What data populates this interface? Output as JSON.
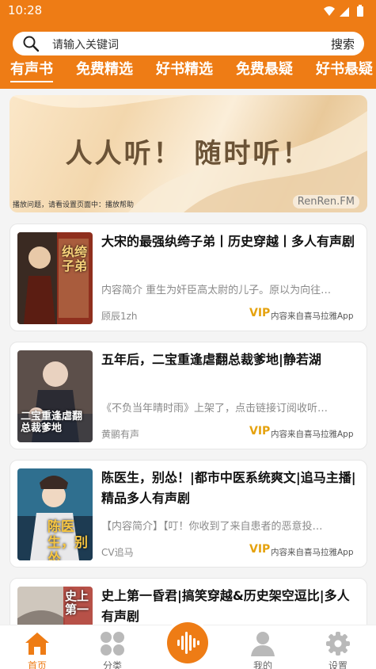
{
  "status_bar": {
    "time": "10:28"
  },
  "search": {
    "placeholder": "请输入关键词",
    "button_label": "搜索"
  },
  "tabs": [
    {
      "label": "有声书",
      "active": true
    },
    {
      "label": "免费精选"
    },
    {
      "label": "好书精选"
    },
    {
      "label": "免费悬疑"
    },
    {
      "label": "好书悬疑"
    }
  ],
  "banner": {
    "title": "人人听！ 随时听！",
    "footnote": "播放问题，请看设置页面中：播放帮助",
    "logo": "RenRen.FM"
  },
  "books": [
    {
      "title": "大宋的最强纨绔子弟丨历史穿越丨多人有声剧",
      "desc": "内容简介 重生为奸臣高太尉的儿子。原以为向往…",
      "author": "顾辰1zh",
      "vip": "VIP",
      "source": "内容来自喜马拉雅App",
      "cover_text": "纨绔子弟"
    },
    {
      "title": "五年后，二宝重逢虐翻总裁爹地|静若湖",
      "desc": "《不负当年晴时雨》上架了，点击链接订阅收听…",
      "author": "黄鹂有声",
      "vip": "VIP",
      "source": "内容来自喜马拉雅App",
      "cover_text": "二宝重逢虐翻总裁爹地"
    },
    {
      "title": "陈医生，别怂！|都市中医系统爽文|追马主播|精品多人有声剧",
      "desc": "【内容简介】【叮！你收到了来自患者的恶意投…",
      "author": "CV追马",
      "vip": "VIP",
      "source": "内容来自喜马拉雅App",
      "cover_text": "陈医生，别怂"
    },
    {
      "title": "史上第一昏君|搞笑穿越&历史架空逗比|多人有声剧",
      "desc": "",
      "author": "",
      "vip": "",
      "source": "",
      "cover_text": "史上第一"
    }
  ],
  "bottom_nav": [
    {
      "label": "首页",
      "icon": "home-icon",
      "active": true
    },
    {
      "label": "分类",
      "icon": "category-icon"
    },
    {
      "label": "",
      "icon": "sound-wave-icon"
    },
    {
      "label": "我的",
      "icon": "person-icon"
    },
    {
      "label": "设置",
      "icon": "gear-icon"
    }
  ],
  "colors": {
    "accent": "#ee7c15",
    "vip": "#e5a20e"
  }
}
